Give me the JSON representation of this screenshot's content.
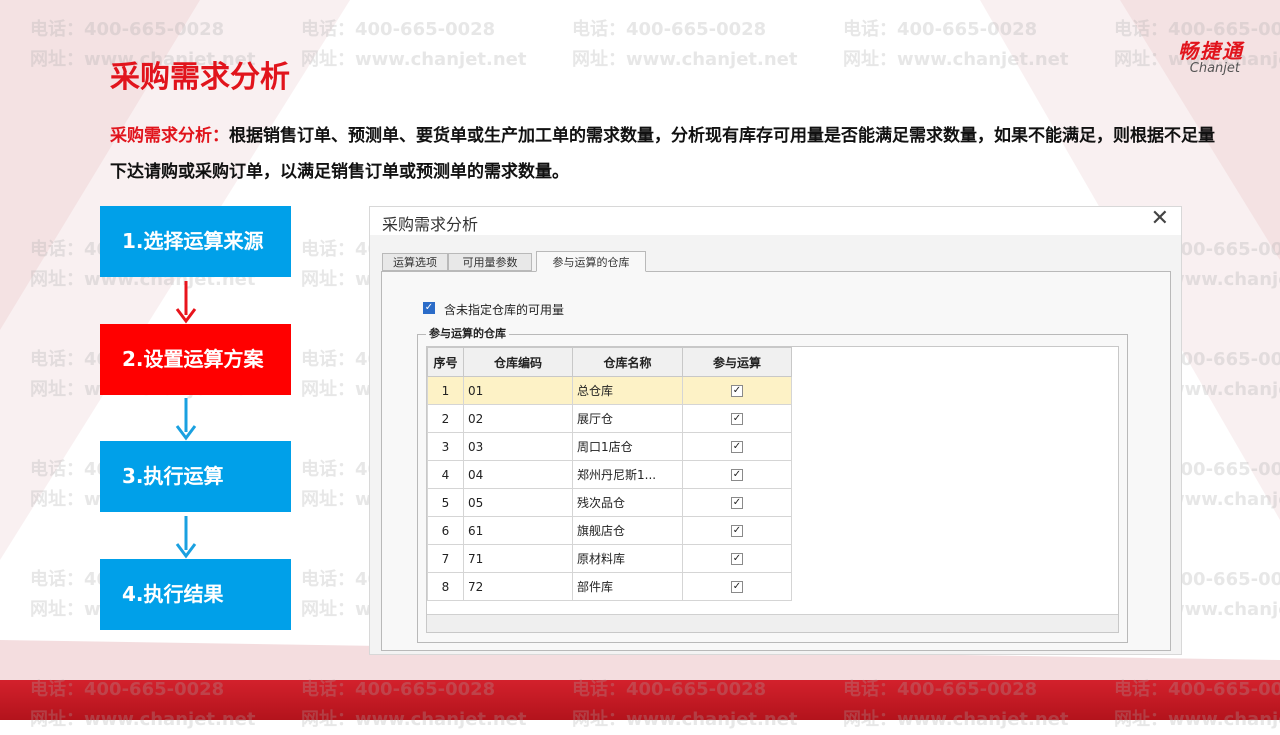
{
  "watermark": {
    "phone": "电话：400-665-0028",
    "site": "网址：www.chanjet.net"
  },
  "logo": {
    "cn": "畅捷通",
    "en": "Chanjet"
  },
  "title": "采购需求分析",
  "description": {
    "lead": "采购需求分析：",
    "body": "根据销售订单、预测单、要货单或生产加工单的需求数量，分析现有库存可用量是否能满足需求数量，如果不能满足，则根据不足量下达请购或采购订单，以满足销售订单或预测单的需求数量。"
  },
  "steps": [
    {
      "label": "1.选择运算来源",
      "active": false
    },
    {
      "label": "2.设置运算方案",
      "active": true
    },
    {
      "label": "3.执行运算",
      "active": false
    },
    {
      "label": "4.执行结果",
      "active": false
    }
  ],
  "colors": {
    "brand_red": "#e1141c",
    "step_blue": "#00a0e9",
    "step_active_red": "#ff0000"
  },
  "dialog": {
    "title": "采购需求分析",
    "close_icon": "close-icon",
    "tabs": [
      {
        "label": "运算选项",
        "active": false
      },
      {
        "label": "可用量参数",
        "active": false
      },
      {
        "label": "参与运算的仓库",
        "active": true
      }
    ],
    "option": {
      "label": "含未指定仓库的可用量",
      "checked": true
    },
    "group_label": "参与运算的仓库",
    "table": {
      "headers": [
        "序号",
        "仓库编码",
        "仓库名称",
        "参与运算"
      ],
      "rows": [
        {
          "no": "1",
          "code": "01",
          "name": "总仓库",
          "checked": true,
          "selected": true
        },
        {
          "no": "2",
          "code": "02",
          "name": "展厅仓",
          "checked": true,
          "selected": false
        },
        {
          "no": "3",
          "code": "03",
          "name": "周口1店仓",
          "checked": true,
          "selected": false
        },
        {
          "no": "4",
          "code": "04",
          "name": "郑州丹尼斯1...",
          "checked": true,
          "selected": false
        },
        {
          "no": "5",
          "code": "05",
          "name": "残次品仓",
          "checked": true,
          "selected": false
        },
        {
          "no": "6",
          "code": "61",
          "name": "旗舰店仓",
          "checked": true,
          "selected": false
        },
        {
          "no": "7",
          "code": "71",
          "name": "原材料库",
          "checked": true,
          "selected": false
        },
        {
          "no": "8",
          "code": "72",
          "name": "部件库",
          "checked": true,
          "selected": false
        }
      ]
    }
  }
}
